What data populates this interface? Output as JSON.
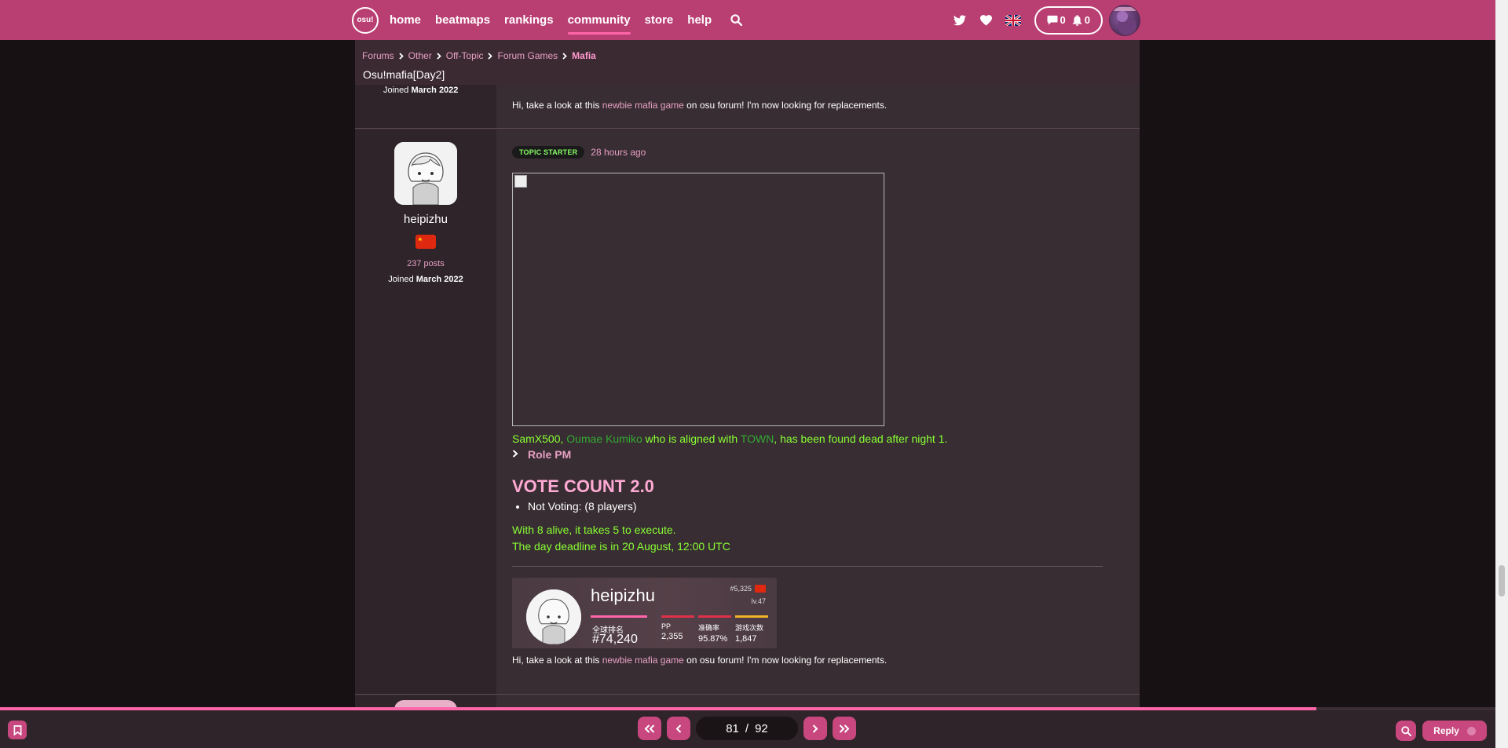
{
  "nav": {
    "logo": "osu!",
    "links": [
      "home",
      "beatmaps",
      "rankings",
      "community",
      "store",
      "help"
    ],
    "active": "community",
    "chat_count": "0",
    "notification_count": "0"
  },
  "breadcrumb": [
    "Forums",
    "Other",
    "Off-Topic",
    "Forum Games",
    "Mafia"
  ],
  "topic_title": "Osu!mafia[Day2]",
  "prev_post": {
    "joined_label": "Joined",
    "joined_date": "March 2022",
    "signature": {
      "prefix": "Hi, take a look at this ",
      "link": "newbie mafia game",
      "suffix": " on osu forum! I'm now looking for replacements."
    }
  },
  "post": {
    "username": "heipizhu",
    "posts": "237 posts",
    "joined_label": "Joined",
    "joined_date": "March 2022",
    "badge": "TOPIC STARTER",
    "time": "28 hours ago",
    "death": {
      "name": "SamX500, ",
      "char": "Oumae Kumiko",
      "mid": " who is aligned with ",
      "team": "TOWN",
      "end": ", has been found dead after night 1."
    },
    "role_pm": "Role PM",
    "vote_title": "VOTE COUNT 2.0",
    "vote_items": [
      "Not Voting: (8 players)"
    ],
    "exec_line": "With 8 alive, it takes 5 to execute.",
    "deadline_line": "The day deadline is in 20 August, 12:00 UTC",
    "sig_card": {
      "name": "heipizhu",
      "country_rank": "#5,325",
      "level": "lv.47",
      "global_label": "全球排名",
      "global_rank": "#74,240",
      "stats": [
        {
          "label": "PP",
          "value": "2,355",
          "color": "#e0304a"
        },
        {
          "label": "准确率",
          "value": "95.87%",
          "color": "#e0304a"
        },
        {
          "label": "游戏次数",
          "value": "1,847",
          "color": "#f0b429"
        }
      ]
    },
    "signature": {
      "prefix": "Hi, take a look at this ",
      "link": "newbie mafia game",
      "suffix": " on osu forum! I'm now looking for replacements."
    }
  },
  "pager": {
    "current": "81",
    "total": "92",
    "progress": 0.88
  },
  "reply_label": "Reply",
  "colors": {
    "accent": "#b93f73",
    "pink": "#ff66aa",
    "green": "#88ff33"
  }
}
